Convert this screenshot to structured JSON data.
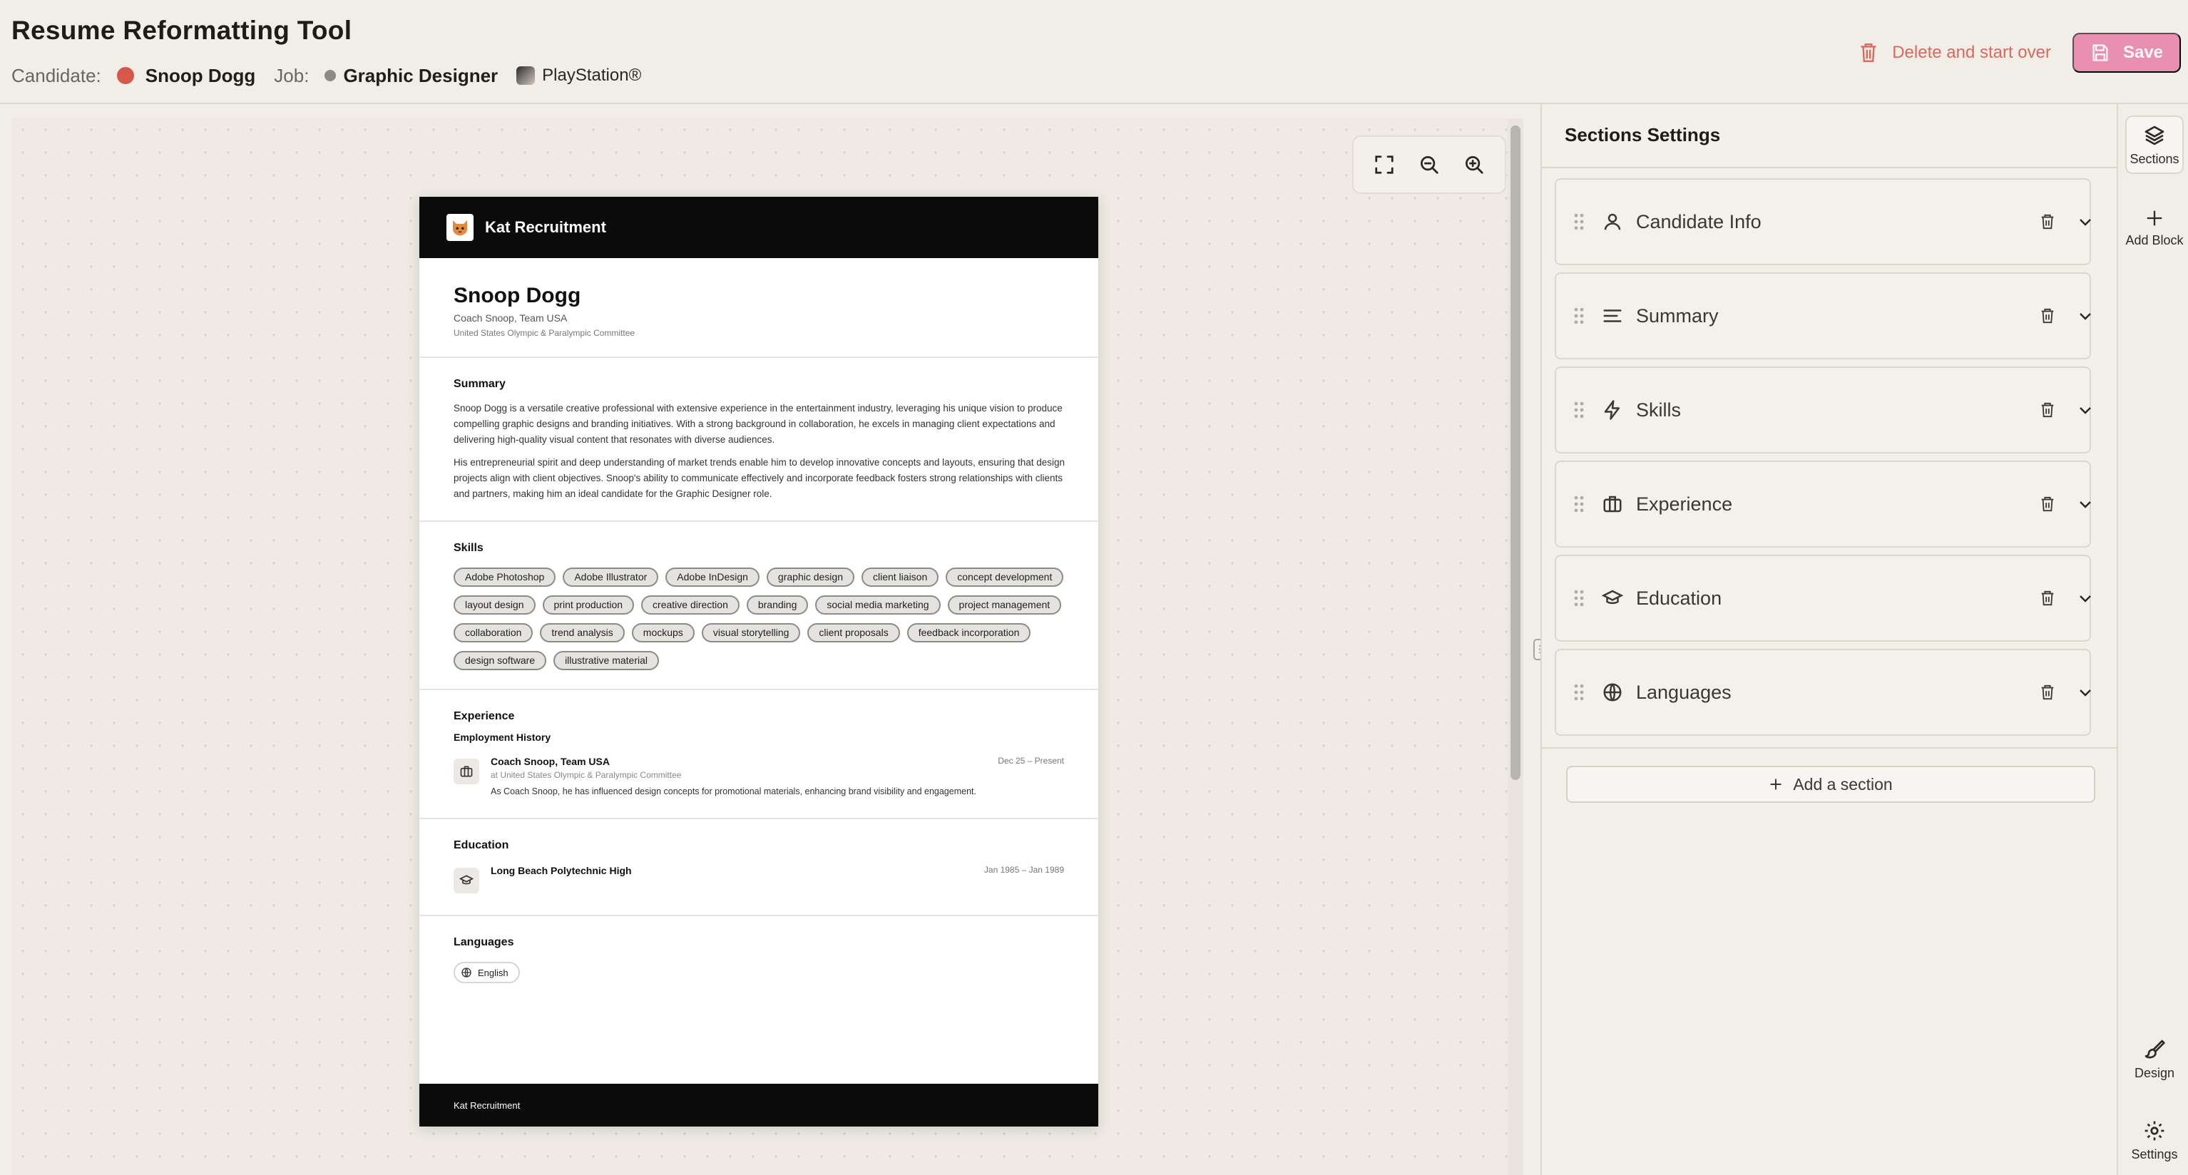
{
  "app": {
    "title": "Resume Reformatting Tool"
  },
  "meta": {
    "candidate_label": "Candidate:",
    "candidate_name": "Snoop Dogg",
    "job_label": "Job:",
    "job_title": "Graphic Designer",
    "company": "PlayStation®"
  },
  "actions": {
    "delete_label": "Delete and start over",
    "save_label": "Save"
  },
  "resume": {
    "brand": "Kat Recruitment",
    "name": "Snoop Dogg",
    "headline": "Coach Snoop, Team USA",
    "organization": "United States Olympic & Paralympic Committee",
    "summary_heading": "Summary",
    "summary_p1": "Snoop Dogg is a versatile creative professional with extensive experience in the entertainment industry, leveraging his unique vision to produce compelling graphic designs and branding initiatives. With a strong background in collaboration, he excels in managing client expectations and delivering high-quality visual content that resonates with diverse audiences.",
    "summary_p2": "His entrepreneurial spirit and deep understanding of market trends enable him to develop innovative concepts and layouts, ensuring that design projects align with client objectives. Snoop's ability to communicate effectively and incorporate feedback fosters strong relationships with clients and partners, making him an ideal candidate for the Graphic Designer role.",
    "skills_heading": "Skills",
    "skills": [
      "Adobe Photoshop",
      "Adobe Illustrator",
      "Adobe InDesign",
      "graphic design",
      "client liaison",
      "concept development",
      "layout design",
      "print production",
      "creative direction",
      "branding",
      "social media marketing",
      "project management",
      "collaboration",
      "trend analysis",
      "mockups",
      "visual storytelling",
      "client proposals",
      "feedback incorporation",
      "design software",
      "illustrative material"
    ],
    "experience_heading": "Experience",
    "employment_history_label": "Employment History",
    "job_title": "Coach Snoop, Team USA",
    "job_dates": "Dec 25 – Present",
    "job_org": "at United States Olympic & Paralympic Committee",
    "job_desc": "As Coach Snoop, he has influenced design concepts for promotional materials, enhancing brand visibility and engagement.",
    "education_heading": "Education",
    "school": "Long Beach Polytechnic High",
    "school_dates": "Jan 1985 – Jan 1989",
    "languages_heading": "Languages",
    "language": "English",
    "footer": "Kat Recruitment"
  },
  "panel": {
    "title": "Sections Settings",
    "sections": [
      {
        "label": "Candidate Info",
        "icon": "user-icon"
      },
      {
        "label": "Summary",
        "icon": "align-left-icon"
      },
      {
        "label": "Skills",
        "icon": "bolt-icon"
      },
      {
        "label": "Experience",
        "icon": "briefcase-icon"
      },
      {
        "label": "Education",
        "icon": "graduation-cap-icon"
      },
      {
        "label": "Languages",
        "icon": "globe-icon"
      }
    ],
    "add_section_label": "Add a section"
  },
  "rail": {
    "sections_label": "Sections",
    "add_block_label": "Add Block",
    "design_label": "Design",
    "settings_label": "Settings"
  },
  "colors": {
    "accent": "#e98fb0",
    "danger": "#d9685e",
    "background": "#f1ede7"
  }
}
